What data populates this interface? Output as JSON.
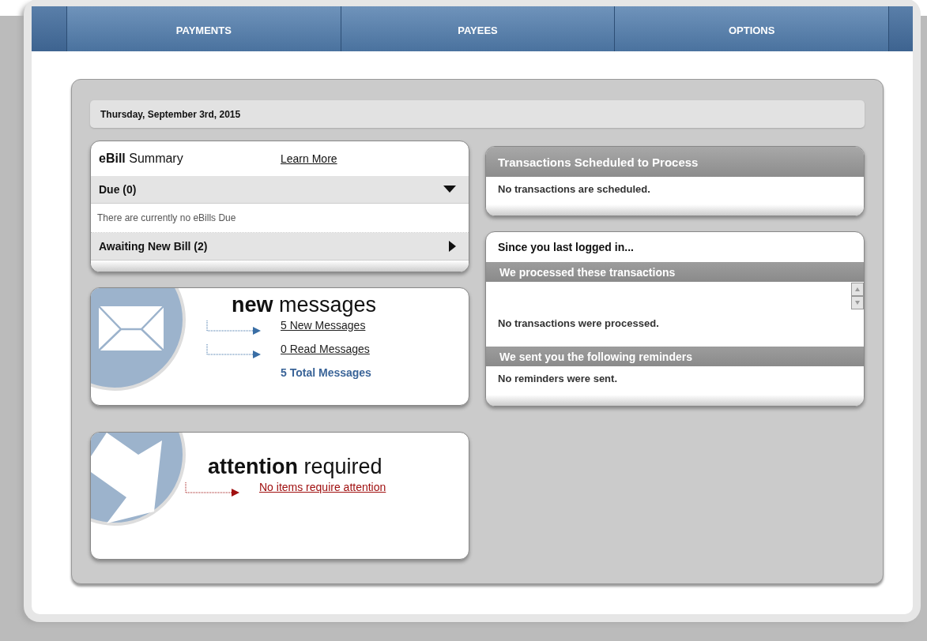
{
  "nav": [
    {
      "label": "PAYMENTS",
      "selected": false
    },
    {
      "label": "PAYEES",
      "selected": false
    },
    {
      "label": "OPTIONS",
      "selected": false
    }
  ],
  "date": "Thursday, September 3rd, 2015",
  "ebill": {
    "title": "**eBill** Summary",
    "learn_more": "Learn More",
    "sections": [
      {
        "label": "Due (0)",
        "expanded": true,
        "message": "There are currently no eBills Due"
      },
      {
        "label": "Awaiting New Bill (2)",
        "expanded": false
      }
    ]
  },
  "messages": {
    "title": "**new** messages",
    "links": [
      "5 New Messages",
      "0 Read Messages"
    ],
    "total": "5 Total Messages"
  },
  "attention": {
    "title": "**attention** required",
    "link": "No items require attention"
  },
  "scheduled": {
    "title": "Transactions Scheduled to Process",
    "message": "No transactions are scheduled."
  },
  "since": {
    "title": "Since you last logged in...",
    "sections": [
      {
        "title": "We processed these transactions",
        "message": "No transactions were processed.",
        "scrollable": true
      },
      {
        "title": "We sent you the following reminders",
        "message": "No reminders were sent.",
        "scrollable": false
      }
    ]
  }
}
